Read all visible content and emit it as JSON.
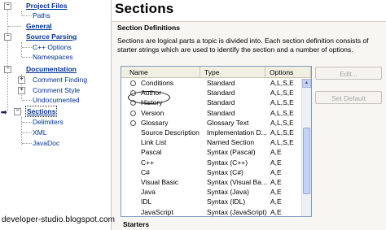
{
  "tree": {
    "items": [
      {
        "label": "Project Files",
        "level": 1,
        "bold": true,
        "expanded": true
      },
      {
        "label": "Paths",
        "level": 2,
        "bold": false
      },
      {
        "label": "General",
        "level": 1,
        "bold": true
      },
      {
        "label": "Source Parsing",
        "level": 1,
        "bold": true,
        "expanded": true
      },
      {
        "label": "C++ Options",
        "level": 2,
        "bold": false
      },
      {
        "label": "Namespaces",
        "level": 2,
        "bold": false
      },
      {
        "label": "Documentation",
        "level": 1,
        "bold": true,
        "expanded": true
      },
      {
        "label": "Comment Finding",
        "level": 2,
        "bold": false,
        "expanded": false
      },
      {
        "label": "Comment Style",
        "level": 2,
        "bold": false,
        "expanded": false
      },
      {
        "label": "Undocumented",
        "level": 2,
        "bold": false
      },
      {
        "label": "Sections",
        "level": 1,
        "bold": true,
        "selected": true,
        "expanded": true
      },
      {
        "label": "Delimiters",
        "level": 2,
        "bold": false
      },
      {
        "label": "XML",
        "level": 2,
        "bold": false
      },
      {
        "label": "JavaDoc",
        "level": 2,
        "bold": false
      }
    ]
  },
  "page": {
    "title": "Sections",
    "subtitle": "Section Definitions",
    "description": "Sections are logical parts a topic is divided into. Each section definition consists of starter strings which are used to identify the section and a number of options."
  },
  "table": {
    "headers": [
      "Name",
      "Type",
      "Options"
    ],
    "rows": [
      {
        "name": "Conditions",
        "type": "Standard",
        "options": "A,L,S,E",
        "radio": true
      },
      {
        "name": "Author",
        "type": "Standard",
        "options": "A,L,S,E",
        "radio": true
      },
      {
        "name": "History",
        "type": "Standard",
        "options": "A,L,S,E",
        "radio": true
      },
      {
        "name": "Version",
        "type": "Standard",
        "options": "A,L,S,E",
        "radio": true
      },
      {
        "name": "Glossary",
        "type": "Glossary Text",
        "options": "A,L,S,E",
        "radio": true
      },
      {
        "name": "Source Description",
        "type": "Implementation D...",
        "options": "A,L,S,E",
        "radio": false
      },
      {
        "name": "Link List",
        "type": "Named Section",
        "options": "A,L,S,E",
        "radio": false
      },
      {
        "name": "Pascal",
        "type": "Syntax (Pascal)",
        "options": "A,E",
        "radio": false
      },
      {
        "name": "C++",
        "type": "Syntax (C++)",
        "options": "A,E",
        "radio": false
      },
      {
        "name": "C#",
        "type": "Syntax (C#)",
        "options": "A,E",
        "radio": false
      },
      {
        "name": "Visual Basic",
        "type": "Syntax (Visual Ba...",
        "options": "A,E",
        "radio": false
      },
      {
        "name": "Java",
        "type": "Syntax (Java)",
        "options": "A,E",
        "radio": false
      },
      {
        "name": "IDL",
        "type": "Syntax (IDL)",
        "options": "A,E",
        "radio": false
      },
      {
        "name": "JavaScript",
        "type": "Syntax (JavaScript)",
        "options": "A,E",
        "radio": false
      }
    ]
  },
  "buttons": {
    "edit": "Edit...",
    "set_default": "Set Default"
  },
  "starters_label": "Starters",
  "watermark": "developer-studio.blogspot.com",
  "colors": {
    "link": "#003399",
    "pane_bg": "#f7f6f2",
    "list_border": "#7f9db9"
  }
}
